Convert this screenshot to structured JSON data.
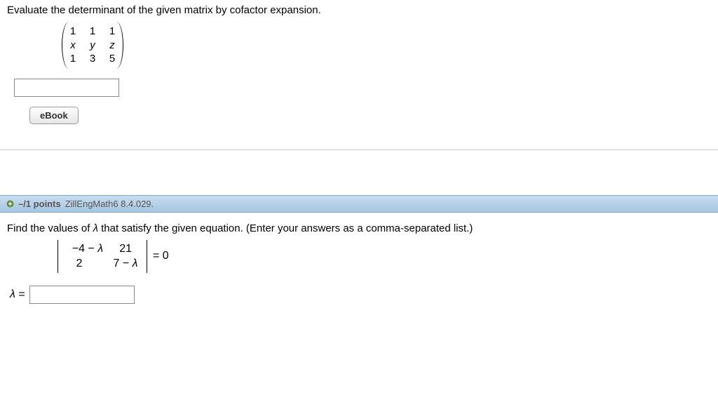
{
  "q1": {
    "prompt": "Evaluate the determinant of the given matrix by cofactor expansion.",
    "matrix": [
      [
        "1",
        "1",
        "1"
      ],
      [
        "x",
        "y",
        "z"
      ],
      [
        "1",
        "3",
        "5"
      ]
    ],
    "ebook_label": "eBook"
  },
  "q2": {
    "points": "–/1 points",
    "ref": "ZillEngMath6 8.4.029.",
    "prompt": "Find the values of λ that satisfy the given equation. (Enter your answers as a comma-separated list.)",
    "det": [
      [
        "−4 − λ",
        "21"
      ],
      [
        "2",
        "7 − λ"
      ]
    ],
    "equals": "= 0",
    "lambda_label": "λ ="
  }
}
